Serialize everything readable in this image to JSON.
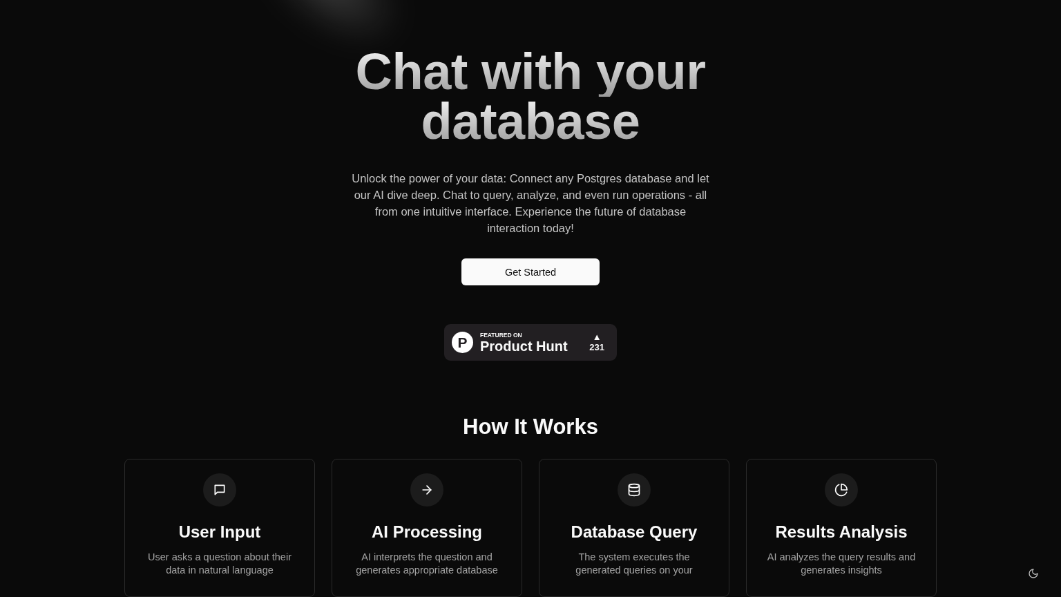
{
  "hero": {
    "title_lines": [
      "Chat with your",
      "database"
    ],
    "description": "Unlock the power of your data: Connect any Postgres database and let our AI dive deep. Chat to query, analyze, and even run operations - all from one intuitive interface. Experience the future of database interaction today!",
    "cta": "Get Started"
  },
  "badge": {
    "logo_letter": "P",
    "caption": "FEATURED ON",
    "name": "Product Hunt",
    "arrow": "▲",
    "votes": "231"
  },
  "how_it_works": {
    "title": "How It Works",
    "steps": [
      {
        "kind": "chat",
        "title": "User Input",
        "lines": [
          "User asks a question about their",
          "data in natural language"
        ]
      },
      {
        "kind": "arrow",
        "title": "AI Processing",
        "lines": [
          "AI interprets the question and",
          "generates appropriate database"
        ]
      },
      {
        "kind": "database",
        "title": "Database Query",
        "lines": [
          "The system executes the",
          "generated queries on your"
        ]
      },
      {
        "kind": "pie",
        "title": "Results Analysis",
        "lines": [
          "AI analyzes the query results and",
          "generates insights"
        ]
      }
    ]
  }
}
